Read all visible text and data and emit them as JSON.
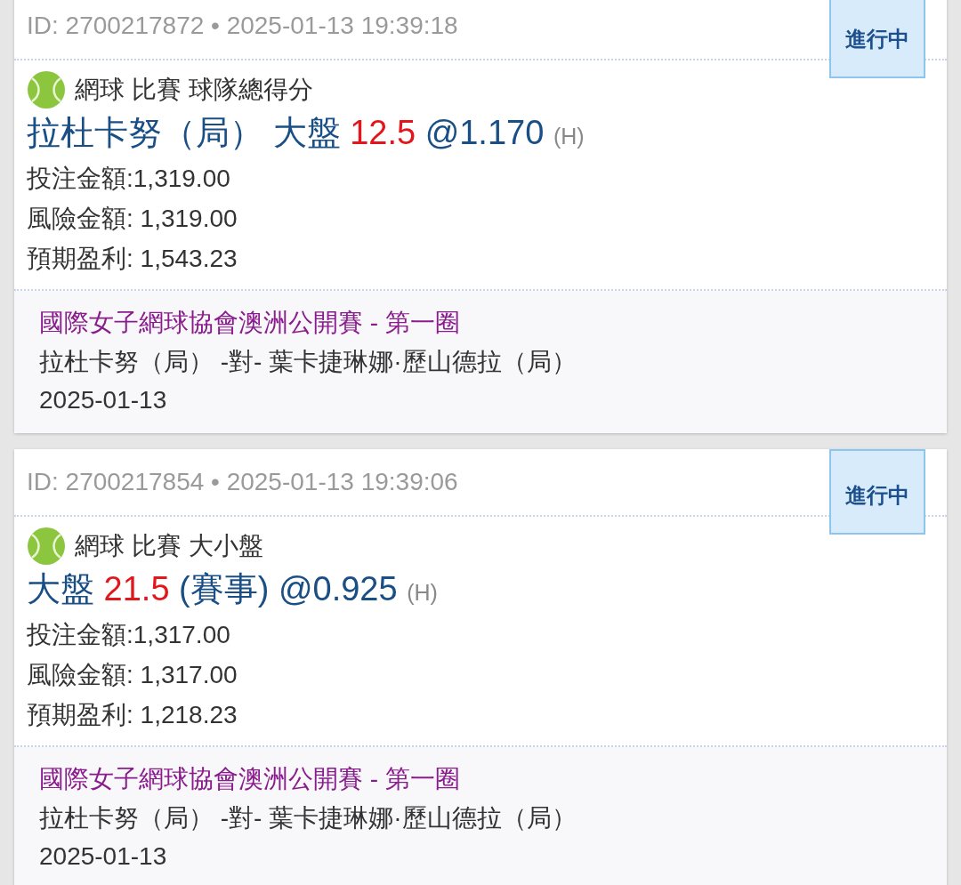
{
  "bets": [
    {
      "id_line": "ID: 2700217872 • 2025-01-13 19:39:18",
      "status": "進行中",
      "sport": "網球 比賽 球隊總得分",
      "bet_parts": [
        {
          "kind": "text",
          "text": "拉杜卡努（局） 大盤"
        },
        {
          "kind": "line",
          "text": "12.5"
        },
        {
          "kind": "text",
          "text": "@1.170"
        },
        {
          "kind": "odds_type",
          "text": "(H)"
        }
      ],
      "amounts": [
        "投注金額:1,319.00",
        "風險金額: 1,319.00",
        "預期盈利: 1,543.23"
      ],
      "league": "國際女子網球協會澳洲公開賽 - 第一圈",
      "match": "拉杜卡努（局） -對- 葉卡捷琳娜·歷山德拉（局）",
      "date": "2025-01-13"
    },
    {
      "id_line": "ID: 2700217854 • 2025-01-13 19:39:06",
      "status": "進行中",
      "sport": "網球 比賽 大小盤",
      "bet_parts": [
        {
          "kind": "text",
          "text": "大盤"
        },
        {
          "kind": "line",
          "text": "21.5"
        },
        {
          "kind": "text",
          "text": "(賽事) @0.925"
        },
        {
          "kind": "odds_type",
          "text": "(H)"
        }
      ],
      "amounts": [
        "投注金額:1,317.00",
        "風險金額: 1,317.00",
        "預期盈利: 1,218.23"
      ],
      "league": "國際女子網球協會澳洲公開賽 - 第一圈",
      "match": "拉杜卡努（局） -對- 葉卡捷琳娜·歷山德拉（局）",
      "date": "2025-01-13"
    }
  ]
}
